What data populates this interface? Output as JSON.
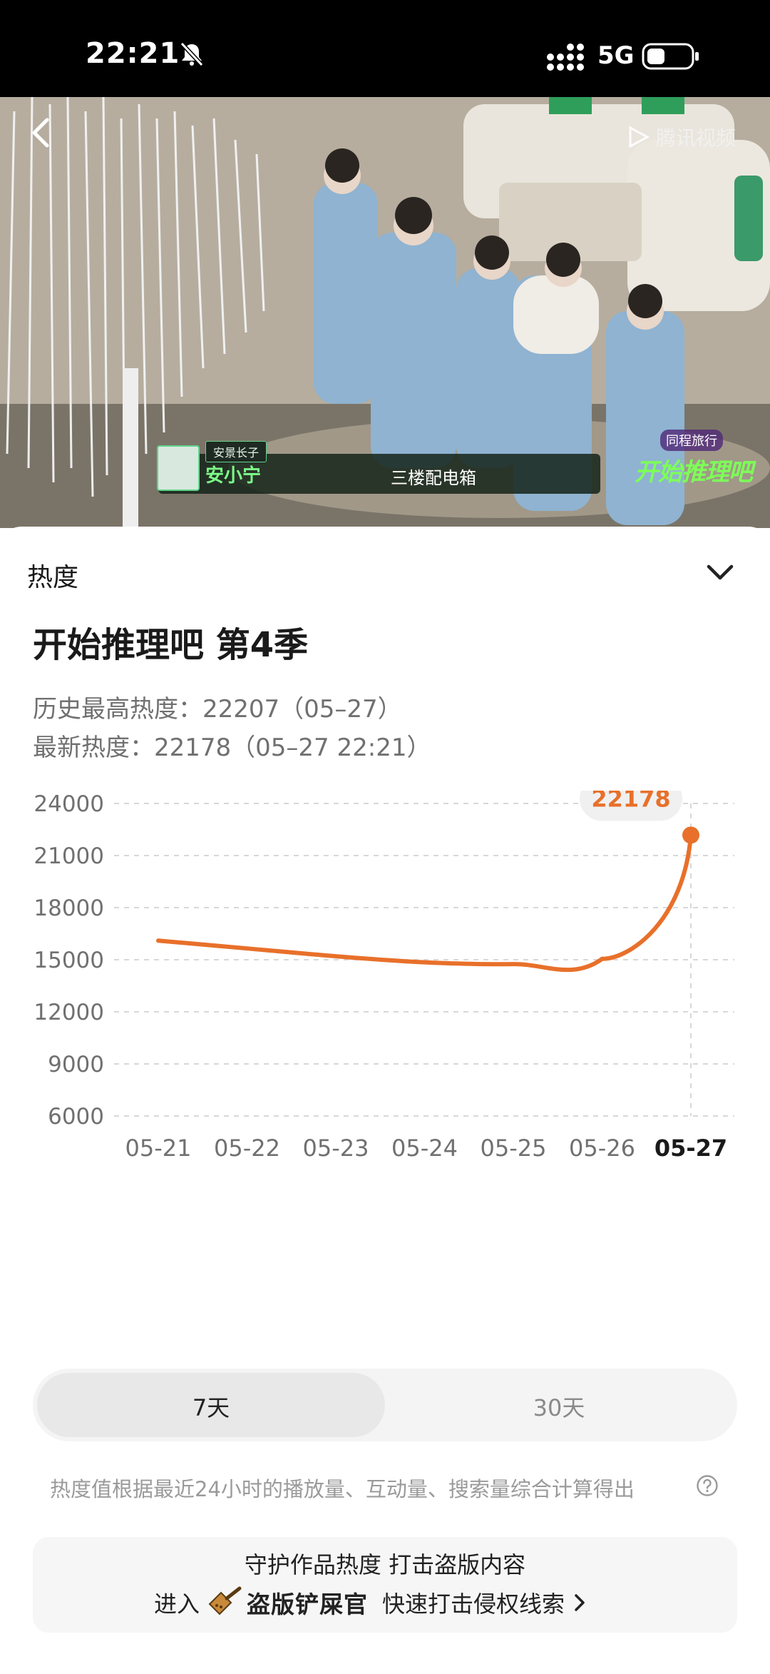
{
  "status_bar": {
    "time": "22:21",
    "network": "5G"
  },
  "video": {
    "watermark": "腾讯视频",
    "lower_third": {
      "tag": "安景长子",
      "name": "安小宁",
      "caption": "三楼配电箱"
    },
    "sponsor": "同程旅行",
    "show_logo": "开始推理吧"
  },
  "sheet": {
    "title": "热度",
    "show_title": "开始推理吧 第4季",
    "history_peak": "历史最高热度：22207（05–27）",
    "latest": "最新热度：22178（05–27 22:21）",
    "range_options": [
      "7天",
      "30天"
    ],
    "selected_range": "7天",
    "note": "热度值根据最近24小时的播放量、互动量、搜索量综合计算得出",
    "banner_line1": "守护作品热度 打击盗版内容",
    "banner_enter": "进入",
    "banner_brand": "盗版铲屎官",
    "banner_action": "快速打击侵权线索"
  },
  "colors": {
    "accent": "#e8702a",
    "grid": "#d8d8d8",
    "muted": "#707070"
  },
  "chart_data": {
    "type": "line",
    "x": [
      "05-21",
      "05-22",
      "05-23",
      "05-24",
      "05-25",
      "05-26",
      "05-27"
    ],
    "series": [
      {
        "values": [
          16100,
          15650,
          15200,
          14850,
          14750,
          15050,
          22178
        ]
      }
    ],
    "ylim": [
      6000,
      24000
    ],
    "yticks": [
      6000,
      9000,
      12000,
      15000,
      18000,
      21000,
      24000
    ],
    "highlight_label": "22178",
    "grid": true
  }
}
